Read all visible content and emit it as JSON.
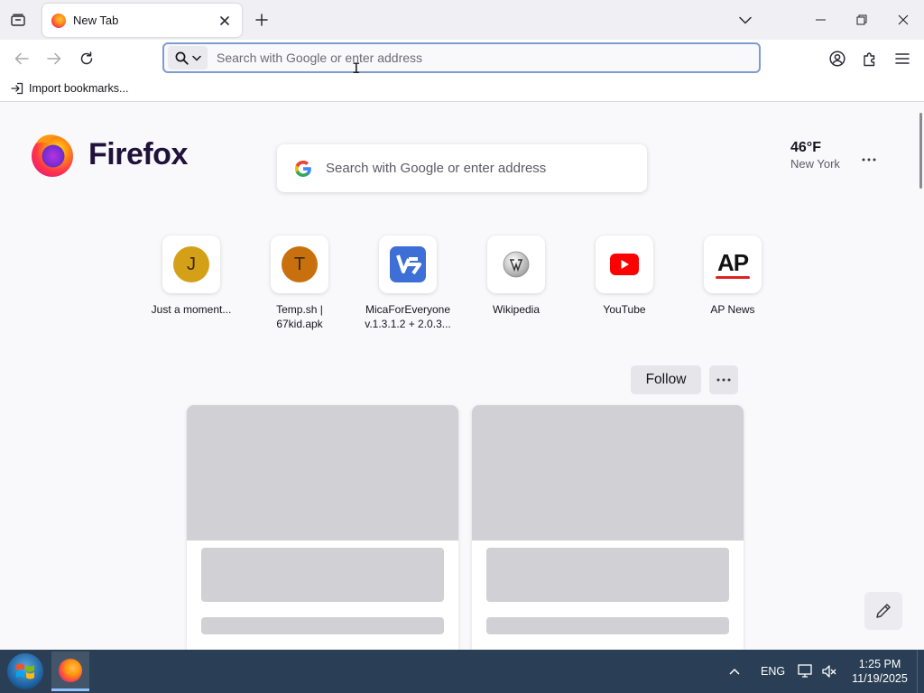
{
  "browser": {
    "tab": {
      "title": "New Tab"
    },
    "urlbar": {
      "placeholder": "Search with Google or enter address",
      "value": ""
    },
    "bookmarks": {
      "import_label": "Import bookmarks..."
    }
  },
  "newtab": {
    "brand": "Firefox",
    "search_placeholder": "Search with Google or enter address",
    "weather": {
      "temperature": "46°F",
      "location": "New York"
    },
    "shortcuts": [
      {
        "label_line1": "Just a moment...",
        "label_line2": "",
        "icon": "letter",
        "letter": "J",
        "color": "#d4a017"
      },
      {
        "label_line1": "Temp.sh |",
        "label_line2": "67kid.apk",
        "icon": "letter",
        "letter": "T",
        "color": "#c8700d"
      },
      {
        "label_line1": "MicaForEveryone",
        "label_line2": "v.1.3.1.2 + 2.0.3...",
        "icon": "micaforeveryone-icon",
        "color": "#3d6fd6"
      },
      {
        "label_line1": "Wikipedia",
        "label_line2": "",
        "icon": "wikipedia-icon"
      },
      {
        "label_line1": "YouTube",
        "label_line2": "",
        "icon": "youtube-icon",
        "color": "#ff0000"
      },
      {
        "label_line1": "AP News",
        "label_line2": "",
        "icon": "ap-news-icon",
        "logo_text": "AP"
      }
    ],
    "follow_label": "Follow"
  },
  "taskbar": {
    "language": "ENG",
    "time": "1:25 PM",
    "date": "11/19/2025"
  },
  "colors": {
    "accent_focus": "#7f9cd2",
    "taskbar_bg": "#2a3f55",
    "page_bg": "#f9f9fb",
    "brand_text": "#20123a"
  }
}
